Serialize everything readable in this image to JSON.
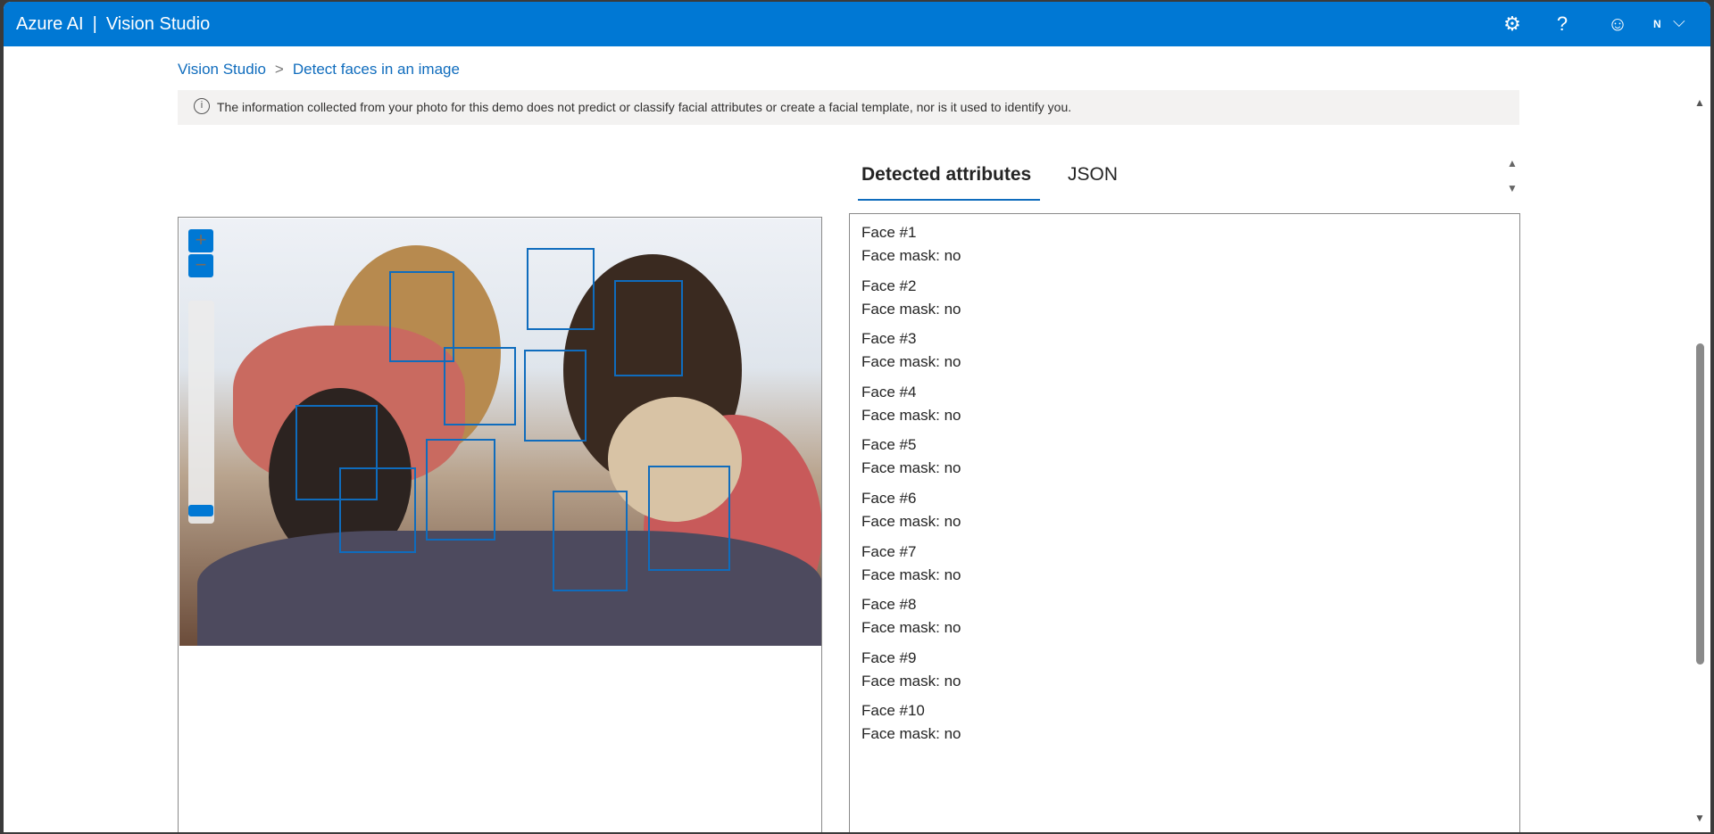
{
  "header": {
    "brand": "Azure AI",
    "separator": "|",
    "app": "Vision Studio",
    "icons": [
      "settings-icon",
      "help-icon",
      "feedback-smiley-icon"
    ],
    "avatar": "N"
  },
  "breadcrumb": {
    "items": [
      "Vision Studio",
      "Detect faces in an image"
    ],
    "separator": ">"
  },
  "notice": "The information collected from your photo for this demo does not predict or classify facial attributes or create a facial template, nor is it used to identify you.",
  "tabs": [
    {
      "label": "Detected attributes",
      "active": true
    },
    {
      "label": "JSON",
      "active": false
    }
  ],
  "zoom": {
    "in": "+",
    "out": "−"
  },
  "faces": [
    {
      "label": "Face #1",
      "mask": "Face mask: no"
    },
    {
      "label": "Face #2",
      "mask": "Face mask: no"
    },
    {
      "label": "Face #3",
      "mask": "Face mask: no"
    },
    {
      "label": "Face #4",
      "mask": "Face mask: no"
    },
    {
      "label": "Face #5",
      "mask": "Face mask: no"
    },
    {
      "label": "Face #6",
      "mask": "Face mask: no"
    },
    {
      "label": "Face #7",
      "mask": "Face mask: no"
    },
    {
      "label": "Face #8",
      "mask": "Face mask: no"
    },
    {
      "label": "Face #9",
      "mask": "Face mask: no"
    },
    {
      "label": "Face #10",
      "mask": "Face mask: no"
    }
  ],
  "colors": {
    "brand": "#0078d4",
    "link": "#0f6cbd"
  }
}
